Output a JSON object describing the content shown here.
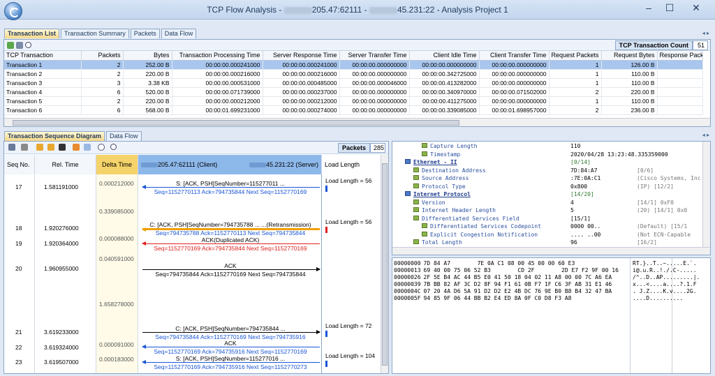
{
  "window": {
    "title_parts": [
      "TCP Flow Analysis - ",
      "205.47:62111 - ",
      "45.231:22 - Analysis Project 1"
    ]
  },
  "top_tabs": [
    "Transaction List",
    "Transaction Summary",
    "Packets",
    "Data Flow"
  ],
  "transactions": {
    "count_label": "TCP Transaction Count",
    "count": "51",
    "columns": [
      "TCP Transaction",
      "Packets",
      "Bytes",
      "Transaction Processing Time",
      "Server Response Time",
      "Server Transfer Time",
      "Client Idle Time",
      "Client Transfer Time",
      "Request Packets",
      "Request Bytes",
      "Response Pack"
    ],
    "rows": [
      [
        "Transaction 1",
        "2",
        "252.00 B",
        "00:00:00.000241000",
        "00:00:00.000241000",
        "00:00:00.000000000",
        "00:00:00.000000000",
        "00:00:00.000000000",
        "1",
        "126.00 B",
        ""
      ],
      [
        "Transaction 2",
        "2",
        "220.00 B",
        "00:00:00.000216000",
        "00:00:00.000216000",
        "00:00:00.000000000",
        "00:00:00.342725000",
        "00:00:00.000000000",
        "1",
        "110.00 B",
        ""
      ],
      [
        "Transaction 3",
        "3",
        "3.38 KB",
        "00:00:00.000531000",
        "00:00:00.000485000",
        "00:00:00.000046000",
        "00:00:00.413282000",
        "00:00:00.000000000",
        "1",
        "110.00 B",
        ""
      ],
      [
        "Transaction 4",
        "6",
        "520.00 B",
        "00:00:00.071739000",
        "00:00:00.000237000",
        "00:00:00.000000000",
        "00:00:00.340970000",
        "00:00:00.071502000",
        "2",
        "220.00 B",
        ""
      ],
      [
        "Transaction 5",
        "2",
        "220.00 B",
        "00:00:00.000212000",
        "00:00:00.000212000",
        "00:00:00.000000000",
        "00:00:00.411275000",
        "00:00:00.000000000",
        "1",
        "110.00 B",
        ""
      ],
      [
        "Transaction 6",
        "6",
        "568.00 B",
        "00:00:01.699231000",
        "00:00:00.000274000",
        "00:00:00.000000000",
        "00:00:00.339085000",
        "00:00:01.698957000",
        "2",
        "236.00 B",
        ""
      ]
    ]
  },
  "lower_tabs": [
    "Transaction Sequence Diagram",
    "Data Flow"
  ],
  "sequence": {
    "packets_label": "Packets",
    "packets_count": "285",
    "headers": {
      "seq": "Seq No.",
      "rel": "Rel. Time",
      "delta": "Delta Time",
      "client": "205.47:62111 (Client)",
      "server": "45.231:22 (Server)",
      "load": "Load Length"
    },
    "rows": [
      {
        "seq": "17",
        "rel": "1.581191000",
        "delta": "0.000212000",
        "label1": "S: [ACK, PSH]SeqNumber=115277011 ...",
        "label2": "Seq=1152770113  Ack=794735844  Next Seq=1152770169",
        "load": "Load Length = 56"
      },
      {
        "seq": "",
        "rel": "",
        "delta": "0.339085000",
        "label1": "",
        "label2": "",
        "load": ""
      },
      {
        "seq": "18",
        "rel": "1.920276000",
        "delta": "",
        "label1": "C: [ACK, PSH]SeqNumber=794735788 ... ...(Retransmission)",
        "label2": "Seq=794735788  Ack=1152770113  Next Seq=794735844",
        "load": "Load Length = 56"
      },
      {
        "seq": "19",
        "rel": "1.920364000",
        "delta": "0.000088000",
        "label1": "ACK(Duplicated ACK)",
        "label2": "Seq=1152770169  Ack=794735844  Next Seq=1152770169",
        "load": ""
      },
      {
        "seq": "",
        "rel": "",
        "delta": "0.040591000",
        "label1": "",
        "label2": "",
        "load": ""
      },
      {
        "seq": "20",
        "rel": "1.960955000",
        "delta": "",
        "label1": "ACK",
        "label2": "Seq=794735844  Ack=1152770169  Next Seq=794735844",
        "load": ""
      },
      {
        "seq": "",
        "rel": "",
        "delta": "1.658278000",
        "label1": "",
        "label2": "",
        "load": ""
      },
      {
        "seq": "21",
        "rel": "3.619233000",
        "delta": "",
        "label1": "C: [ACK, PSH]SeqNumber=794735844 ...",
        "label2": "Seq=794735844  Ack=1152770169  Next Seq=794735916",
        "load": "Load Length = 72"
      },
      {
        "seq": "22",
        "rel": "3.619324000",
        "delta": "0.000091000",
        "label1": "ACK",
        "label2": "Seq=1152770169  Ack=794735916  Next Seq=1152770169",
        "load": ""
      },
      {
        "seq": "23",
        "rel": "3.619507000",
        "delta": "0.000183000",
        "label1": "S: [ACK, PSH]SeqNumber=115277016 ...",
        "label2": "Seq=1152770169  Ack=794735916  Next Seq=1152770273",
        "load": "Load Length = 104"
      }
    ],
    "colors": {
      "client_to_server": "#000000",
      "server_to_client": "#1a55d8",
      "retransmission": "#f0a000",
      "dup_ack": "#e02020"
    }
  },
  "details": [
    {
      "indent": 2,
      "name": "Capture Length",
      "value": "110",
      "extra": ""
    },
    {
      "indent": 2,
      "name": "Timestamp",
      "value": "2020/04/28 13:23:48.335359000",
      "extra": ""
    },
    {
      "indent": 0,
      "name": "Ethernet - II",
      "value": "[0/14]",
      "extra": "",
      "link": true
    },
    {
      "indent": 1,
      "name": "Destination Address",
      "value": "7D:84:A7",
      "extra": "[0/6]"
    },
    {
      "indent": 1,
      "name": "Source Address",
      "value": ":7E:0A:C1",
      "extra": "(Cisco Systems, Inc"
    },
    {
      "indent": 1,
      "name": "Protocol Type",
      "value": "0x800",
      "extra": "(IP) [12/2]"
    },
    {
      "indent": 0,
      "name": "Internet Protocol",
      "value": "[14/20]",
      "extra": "",
      "link": true
    },
    {
      "indent": 1,
      "name": "Version",
      "value": "4",
      "extra": "[14/1] 0xF0"
    },
    {
      "indent": 1,
      "name": "Internet Header Length",
      "value": "5",
      "extra": "(20) [14/1] 0x0"
    },
    {
      "indent": 1,
      "name": "Differentiated Services Field",
      "value": "[15/1]",
      "extra": ""
    },
    {
      "indent": 2,
      "name": "Differentiated Services Codepoint",
      "value": "0000 00..",
      "extra": "(Default) [15/1"
    },
    {
      "indent": 2,
      "name": "Explicit Congestion Notification",
      "value": ".... ..00",
      "extra": "(Not ECN-Capable"
    },
    {
      "indent": 1,
      "name": "Total Length",
      "value": "96",
      "extra": "[16/2]"
    }
  ],
  "hex": [
    {
      "offset": "00000000",
      "bytes": "7D 84 A7        7E 0A C1 08 00 45 00 00 60 E3",
      "ascii": "RT.}..T..~.....E.`."
    },
    {
      "offset": "00000013",
      "bytes": "69 40 00 75 06 52 B3        CD 2F        2D E7 F2 9F 00 16",
      "ascii": "i@.u.R..!./.C-....."
    },
    {
      "offset": "00000026",
      "bytes": "2F 5E B4 AC 44 B5 E0 41 50 18 04 02 11 A8 00 00 7C A6 EA",
      "ascii": "/^..D..AP.........|."
    },
    {
      "offset": "00000039",
      "bytes": "7B BB 82 AF 3C D2 8F 94 F1 61 0B F7 1F C6 3F AB 31 E1 46",
      "ascii": "x...<....a....?.1.F"
    },
    {
      "offset": "0000004C",
      "bytes": "07 20 4A D6 5A 91 D2 D2 E2 4B DC 76 9E B0 B8 B4 32 47 BA",
      "ascii": ". J.Z....K.v....2G."
    },
    {
      "offset": "0000005F",
      "bytes": "94 85 9F 06 44 BB B2 E4 ED 8A 0F C0 D8 F3 A8",
      "ascii": "....D.........."
    }
  ]
}
